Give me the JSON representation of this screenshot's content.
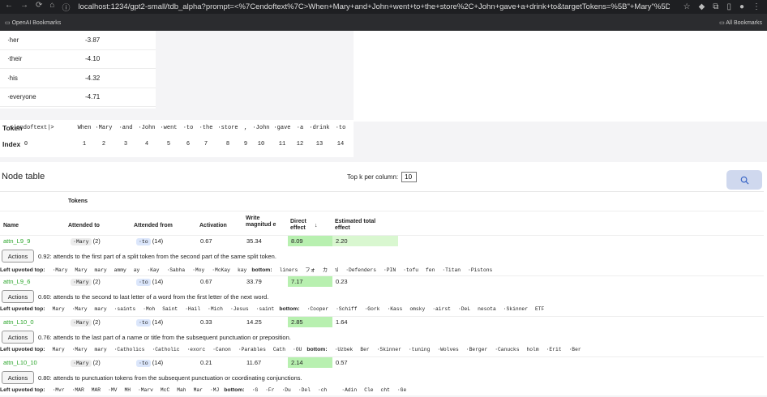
{
  "browser": {
    "url": "localhost:1234/gpt2-small/tdb_alpha?prompt=<%7Cendoftext%7C>When+Mary+and+John+went+to+the+store%2C+John+gave+a+drink+to&targetTokens=%5B\"+Mary\"%5D&distractorT...",
    "bookmarks_left": "OpenAI Bookmarks",
    "bookmarks_right": "All Bookmarks"
  },
  "logits": [
    {
      "token": "·her",
      "value": "-3.87"
    },
    {
      "token": "·their",
      "value": "-4.10"
    },
    {
      "token": "·his",
      "value": "-4.32"
    },
    {
      "token": "·everyone",
      "value": "-4.71"
    }
  ],
  "tokens": {
    "token_label": "Token",
    "index_label": "Index",
    "items": [
      {
        "t": "<|endoftext|>",
        "i": "0"
      },
      {
        "t": "When",
        "i": "1"
      },
      {
        "t": "·Mary",
        "i": "2"
      },
      {
        "t": "·and",
        "i": "3"
      },
      {
        "t": "·John",
        "i": "4"
      },
      {
        "t": "·went",
        "i": "5"
      },
      {
        "t": "·to",
        "i": "6"
      },
      {
        "t": "·the",
        "i": "7"
      },
      {
        "t": "·store",
        "i": "8"
      },
      {
        "t": ",",
        "i": "9"
      },
      {
        "t": "·John",
        "i": "10"
      },
      {
        "t": "·gave",
        "i": "11"
      },
      {
        "t": "·a",
        "i": "12"
      },
      {
        "t": "·drink",
        "i": "13"
      },
      {
        "t": "·to",
        "i": "14"
      }
    ]
  },
  "node_table": {
    "title": "Node table",
    "topk_label": "Top k per column:",
    "topk_value": "10",
    "headers": {
      "tokens": "Tokens",
      "name": "Name",
      "attended_to": "Attended to",
      "attended_from": "Attended from",
      "activation": "Activation",
      "write_magnitude": "Write magnitud e",
      "direct_effect": "Direct effect",
      "sort_arrow": "↓",
      "estimated_total": "Estimated total effect"
    },
    "actions_label": "Actions",
    "upvoted_label": "Left upvoted top:",
    "bottom_label": "bottom:",
    "rows": [
      {
        "name": "attn_L9_9",
        "to_tok": "·Mary",
        "to_idx": "(2)",
        "from_tok": "·to",
        "from_idx": "(14)",
        "activation": "0.67",
        "write": "35.34",
        "direct": "8.09",
        "total": "2.20",
        "desc": "0.92: attends to the first part of a split token from the second part of the same split token.",
        "top": [
          "·Mary",
          "Mary",
          "mary",
          "ammy",
          "ay",
          "·Kay",
          "·Sabha",
          "·Moy",
          "·McKay",
          "kay"
        ],
        "bottom": [
          "liners",
          "フォ",
          "カ",
          "ป",
          "·Defenders",
          "·PIN",
          "·tofu",
          "fen",
          "·Titan",
          "·Pistons"
        ]
      },
      {
        "name": "attn_L9_6",
        "to_tok": "·Mary",
        "to_idx": "(2)",
        "from_tok": "·to",
        "from_idx": "(14)",
        "activation": "0.67",
        "write": "33.79",
        "direct": "7.17",
        "total": "0.23",
        "desc": "0.60: attends to the second to last letter of a word from the first letter of the next word.",
        "top": [
          "Mary",
          "·Mary",
          "mary",
          "·saints",
          "·Moh",
          "Saint",
          "·Hail",
          "·Mich",
          "·Jesus",
          "·saint"
        ],
        "bottom": [
          "·Cooper",
          "·Schiff",
          "·Gork",
          "·Kass",
          "omsky",
          "·airst",
          "·DeL",
          "nesota",
          "·Skinner",
          "ETF"
        ]
      },
      {
        "name": "attn_L10_0",
        "to_tok": "·Mary",
        "to_idx": "(2)",
        "from_tok": "·to",
        "from_idx": "(14)",
        "activation": "0.33",
        "write": "14.25",
        "direct": "2.85",
        "total": "1.64",
        "desc": "0.76: attends to the last part of a name or title from the subsequent punctuation or preposition.",
        "top": [
          "Mary",
          "·Mary",
          "mary",
          "·Catholics",
          "·Catholic",
          "·exorc",
          "·Canon",
          "·Parables",
          "Cath",
          "·OU"
        ],
        "bottom": [
          "·Uzbek",
          "Ber",
          "·Skinner",
          "·tuning",
          "·Wolves",
          "·Berger",
          "·Canucks",
          "holm",
          "·Erit",
          "·Ber"
        ]
      },
      {
        "name": "attn_L10_10",
        "to_tok": "·Mary",
        "to_idx": "(2)",
        "from_tok": "·to",
        "from_idx": "(14)",
        "activation": "0.21",
        "write": "11.67",
        "direct": "2.14",
        "total": "0.57",
        "desc": "0.80: attends to punctuation tokens from the subsequent punctuation or coordinating conjunctions.",
        "top": [
          "·Mvr",
          "·MAR",
          "MAR",
          "·MV",
          "MH",
          "·Marv",
          "McC",
          "Mah",
          "Mar",
          "·MJ"
        ],
        "bottom": [
          "·G",
          "·Fr",
          "·Du",
          "·Del",
          "·ch",
          "",
          "·Adin",
          "Cle",
          "cht",
          "·Ge"
        ]
      }
    ]
  }
}
